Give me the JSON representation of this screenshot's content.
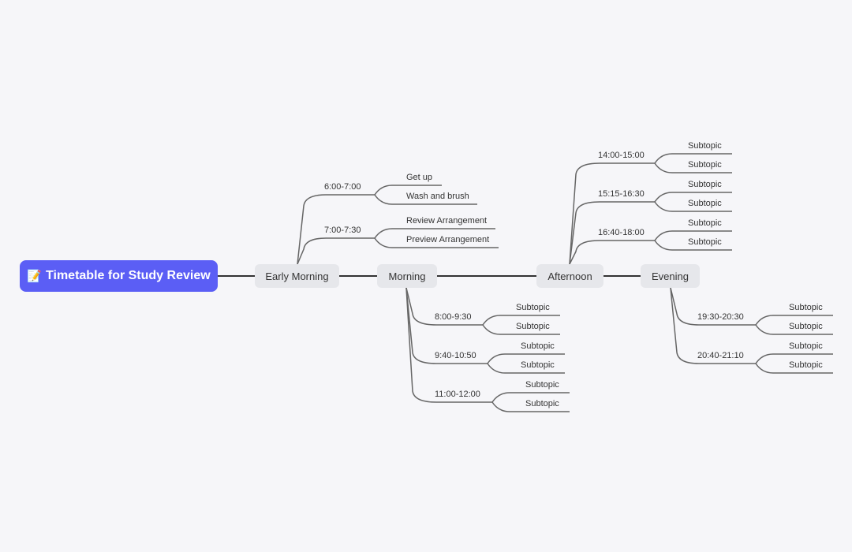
{
  "root": {
    "icon": "memo-emoji",
    "emoji": "📝",
    "title": "Timetable for Study Review"
  },
  "topics": [
    {
      "label": "Early Morning",
      "subtopics": [
        {
          "label": "6:00-7:00",
          "children": [
            "Get up",
            "Wash and brush"
          ]
        },
        {
          "label": "7:00-7:30",
          "children": [
            "Review Arrangement",
            "Preview Arrangement"
          ]
        }
      ]
    },
    {
      "label": "Morning",
      "subtopics": [
        {
          "label": "8:00-9:30",
          "children": [
            "Subtopic",
            "Subtopic"
          ]
        },
        {
          "label": "9:40-10:50",
          "children": [
            "Subtopic",
            "Subtopic"
          ]
        },
        {
          "label": "11:00-12:00",
          "children": [
            "Subtopic",
            "Subtopic"
          ]
        }
      ]
    },
    {
      "label": "Afternoon",
      "subtopics": [
        {
          "label": "14:00-15:00",
          "children": [
            "Subtopic",
            "Subtopic"
          ]
        },
        {
          "label": "15:15-16:30",
          "children": [
            "Subtopic",
            "Subtopic"
          ]
        },
        {
          "label": "16:40-18:00",
          "children": [
            "Subtopic",
            "Subtopic"
          ]
        }
      ]
    },
    {
      "label": "Evening",
      "subtopics": [
        {
          "label": "19:30-20:30",
          "children": [
            "Subtopic",
            "Subtopic"
          ]
        },
        {
          "label": "20:40-21:10",
          "children": [
            "Subtopic",
            "Subtopic"
          ]
        }
      ]
    }
  ],
  "colors": {
    "root_bg": "#5b5ef5",
    "topic_bg": "#e6e7eb",
    "line": "#555555",
    "background": "#f6f6f9"
  }
}
